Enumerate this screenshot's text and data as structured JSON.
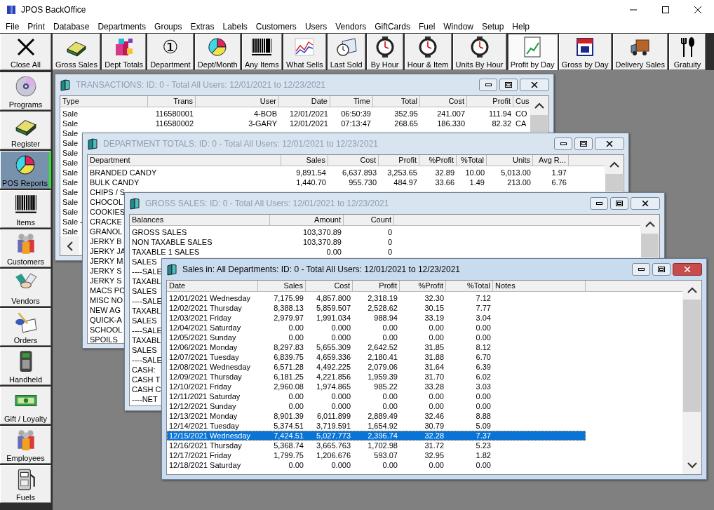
{
  "app": {
    "title": "JPOS BackOffice"
  },
  "menu": [
    "File",
    "Print",
    "Database",
    "Departments",
    "Groups",
    "Extras",
    "Labels",
    "Customers",
    "Users",
    "Vendors",
    "GiftCards",
    "Fuel",
    "Window",
    "Setup",
    "Help"
  ],
  "toolbar": [
    {
      "label": "Close All",
      "selected": false
    },
    {
      "label": "Gross Sales",
      "selected": false
    },
    {
      "label": "Dept Totals",
      "selected": false
    },
    {
      "label": "Department",
      "glyph": "①",
      "selected": false
    },
    {
      "label": "Dept/Month",
      "selected": false
    },
    {
      "label": "Any Items",
      "selected": false
    },
    {
      "label": "What Sells",
      "selected": false
    },
    {
      "label": "Last Sold",
      "selected": false
    },
    {
      "label": "By Hour",
      "selected": false
    },
    {
      "label": "Hour & Item",
      "selected": false
    },
    {
      "label": "Units By Hour",
      "selected": false
    },
    {
      "label": "Profit by Day",
      "selected": true
    },
    {
      "label": "Gross by Day",
      "selected": false
    },
    {
      "label": "Delivery Sales",
      "selected": false
    },
    {
      "label": "Gratuity",
      "selected": false
    }
  ],
  "sidebar": [
    {
      "label": "Programs",
      "selected": false
    },
    {
      "label": "Register",
      "selected": false
    },
    {
      "label": "POS Reports",
      "selected": true
    },
    {
      "label": "Items",
      "selected": false
    },
    {
      "label": "Customers",
      "selected": false
    },
    {
      "label": "Vendors",
      "selected": false
    },
    {
      "label": "Orders",
      "selected": false
    },
    {
      "label": "Handheld",
      "selected": false
    },
    {
      "label": "Gift / Loyalty",
      "selected": false
    },
    {
      "label": "Employees",
      "selected": false
    },
    {
      "label": "Fuels",
      "selected": false
    }
  ],
  "windows": [
    {
      "title": "TRANSACTIONS: ID: 0 - Total All Users: 12/01/2021 to 12/23/2021",
      "active": false,
      "columns": [
        "Type",
        "Trans",
        "User",
        "Date",
        "Time",
        "Total",
        "Cost",
        "Profit",
        "Cus"
      ],
      "rows": [
        {
          "cells": [
            "Sale",
            "116580001",
            "4-BOB",
            "12/01/2021",
            "06:50:39",
            "352.95",
            "241.007",
            "111.94",
            "CO"
          ]
        },
        {
          "cells": [
            "Sale",
            "116580002",
            "3-GARY",
            "12/01/2021",
            "07:13:47",
            "268.65",
            "186.330",
            "82.32",
            "CA"
          ]
        },
        {
          "cells": [
            "Sale"
          ]
        },
        {
          "cells": [
            "Sale"
          ]
        },
        {
          "cells": [
            "Sale"
          ]
        },
        {
          "cells": [
            "Sale"
          ]
        },
        {
          "cells": [
            "Sale"
          ]
        },
        {
          "cells": [
            "Sale"
          ]
        },
        {
          "cells": [
            "Sale"
          ]
        },
        {
          "cells": [
            "Sale"
          ]
        },
        {
          "cells": [
            "Sale"
          ]
        },
        {
          "cells": [
            "Sale -"
          ]
        },
        {
          "cells": [
            "Sale"
          ]
        }
      ]
    },
    {
      "title": "DEPARTMENT TOTALS: ID: 0 - Total All Users: 12/01/2021 to 12/23/2021",
      "active": false,
      "columns": [
        "Department",
        "Sales",
        "Cost",
        "Profit",
        "%Profit",
        "%Total",
        "Units",
        "Avg R..."
      ],
      "rows": [
        {
          "cells": [
            "BRANDED CANDY",
            "9,891.54",
            "6,637.893",
            "3,253.65",
            "32.89",
            "10.00",
            "5,013.00",
            "1.97"
          ]
        },
        {
          "cells": [
            "BULK CANDY",
            "1,440.70",
            "955.730",
            "484.97",
            "33.66",
            "1.49",
            "213.00",
            "6.76"
          ]
        },
        {
          "cells": [
            "CHIPS / S"
          ]
        },
        {
          "cells": [
            "CHOCOL"
          ]
        },
        {
          "cells": [
            "COOKIES"
          ]
        },
        {
          "cells": [
            "CRACKE"
          ]
        },
        {
          "cells": [
            "GRANOL"
          ]
        },
        {
          "cells": [
            "JERKY B"
          ]
        },
        {
          "cells": [
            "JERKY JA"
          ]
        },
        {
          "cells": [
            "JERKY M"
          ]
        },
        {
          "cells": [
            "JERKY S"
          ]
        },
        {
          "cells": [
            "JERKY S"
          ]
        },
        {
          "cells": [
            "MACS PO"
          ]
        },
        {
          "cells": [
            "MISC NO"
          ]
        },
        {
          "cells": [
            "NEW AG"
          ]
        },
        {
          "cells": [
            "QUICK-A"
          ]
        },
        {
          "cells": [
            "SCHOOL"
          ]
        },
        {
          "cells": [
            "SPOILS"
          ]
        }
      ]
    },
    {
      "title": "GROSS SALES: ID: 0 - Total All Users: 12/01/2021 to 12/23/2021",
      "active": false,
      "columns": [
        "Balances",
        "Amount",
        "Count"
      ],
      "rows": [
        {
          "cells": [
            "GROSS SALES",
            "103,370.89",
            "0"
          ]
        },
        {
          "cells": [
            "NON TAXABLE SALES",
            "103,370.89",
            "0"
          ]
        },
        {
          "cells": [
            "TAXABLE 1 SALES",
            "0.00",
            "0"
          ]
        },
        {
          "cells": [
            "SALES"
          ]
        },
        {
          "cells": [
            "----SALE"
          ]
        },
        {
          "cells": [
            "TAXABL"
          ]
        },
        {
          "cells": [
            "SALES"
          ]
        },
        {
          "cells": [
            "----SALE"
          ]
        },
        {
          "cells": [
            "TAXABL"
          ]
        },
        {
          "cells": [
            "SALES"
          ]
        },
        {
          "cells": [
            "----SALE"
          ]
        },
        {
          "cells": [
            "TAXABL"
          ]
        },
        {
          "cells": [
            "SALES"
          ]
        },
        {
          "cells": [
            "----SALE"
          ]
        },
        {
          "cells": [
            "CASH:"
          ]
        },
        {
          "cells": [
            "CASH T"
          ]
        },
        {
          "cells": [
            "CASH C"
          ]
        },
        {
          "cells": [
            "----NET"
          ]
        }
      ]
    },
    {
      "title": "Sales in: All Departments: ID: 0 - Total All Users: 12/01/2021 to 12/23/2021",
      "active": true,
      "columns": [
        "Date",
        "Sales",
        "Cost",
        "Profit",
        "%Profit",
        "%Total",
        "Notes"
      ],
      "rows": [
        {
          "selected": false,
          "cells": [
            "12/01/2021 Wednesday",
            "7,175.99",
            "4,857.800",
            "2,318.19",
            "32.30",
            "7.12"
          ]
        },
        {
          "selected": false,
          "cells": [
            "12/02/2021 Thursday",
            "8,388.13",
            "5,859.507",
            "2,528.62",
            "30.15",
            "7.77"
          ]
        },
        {
          "selected": false,
          "cells": [
            "12/03/2021 Friday",
            "2,979.97",
            "1,991.034",
            "988.94",
            "33.19",
            "3.04"
          ]
        },
        {
          "selected": false,
          "cells": [
            "12/04/2021 Saturday",
            "0.00",
            "0.000",
            "0.00",
            "0.00",
            "0.00"
          ]
        },
        {
          "selected": false,
          "cells": [
            "12/05/2021 Sunday",
            "0.00",
            "0.000",
            "0.00",
            "0.00",
            "0.00"
          ]
        },
        {
          "selected": false,
          "cells": [
            "12/06/2021 Monday",
            "8,297.83",
            "5,655.309",
            "2,642.52",
            "31.85",
            "8.12"
          ]
        },
        {
          "selected": false,
          "cells": [
            "12/07/2021 Tuesday",
            "6,839.75",
            "4,659.336",
            "2,180.41",
            "31.88",
            "6.70"
          ]
        },
        {
          "selected": false,
          "cells": [
            "12/08/2021 Wednesday",
            "6,571.28",
            "4,492.225",
            "2,079.06",
            "31.64",
            "6.39"
          ]
        },
        {
          "selected": false,
          "cells": [
            "12/09/2021 Thursday",
            "6,181.25",
            "4,221.856",
            "1,959.39",
            "31.70",
            "6.02"
          ]
        },
        {
          "selected": false,
          "cells": [
            "12/10/2021 Friday",
            "2,960.08",
            "1,974.865",
            "985.22",
            "33.28",
            "3.03"
          ]
        },
        {
          "selected": false,
          "cells": [
            "12/11/2021 Saturday",
            "0.00",
            "0.000",
            "0.00",
            "0.00",
            "0.00"
          ]
        },
        {
          "selected": false,
          "cells": [
            "12/12/2021 Sunday",
            "0.00",
            "0.000",
            "0.00",
            "0.00",
            "0.00"
          ]
        },
        {
          "selected": false,
          "cells": [
            "12/13/2021 Monday",
            "8,901.39",
            "6,011.899",
            "2,889.49",
            "32.46",
            "8.88"
          ]
        },
        {
          "selected": false,
          "cells": [
            "12/14/2021 Tuesday",
            "5,374.51",
            "3,719.591",
            "1,654.92",
            "30.79",
            "5.09"
          ]
        },
        {
          "selected": true,
          "cells": [
            "12/15/2021 Wednesday",
            "7,424.51",
            "5,027.773",
            "2,396.74",
            "32.28",
            "7.37"
          ]
        },
        {
          "selected": false,
          "cells": [
            "12/16/2021 Thursday",
            "5,368.74",
            "3,665.763",
            "1,702.98",
            "31.72",
            "5.23"
          ]
        },
        {
          "selected": false,
          "cells": [
            "12/17/2021 Friday",
            "1,799.75",
            "1,206.676",
            "593.07",
            "32.95",
            "1.82"
          ]
        },
        {
          "selected": false,
          "cells": [
            "12/18/2021 Saturday",
            "0.00",
            "0.000",
            "0.00",
            "0.00",
            "0.00"
          ]
        }
      ]
    }
  ]
}
